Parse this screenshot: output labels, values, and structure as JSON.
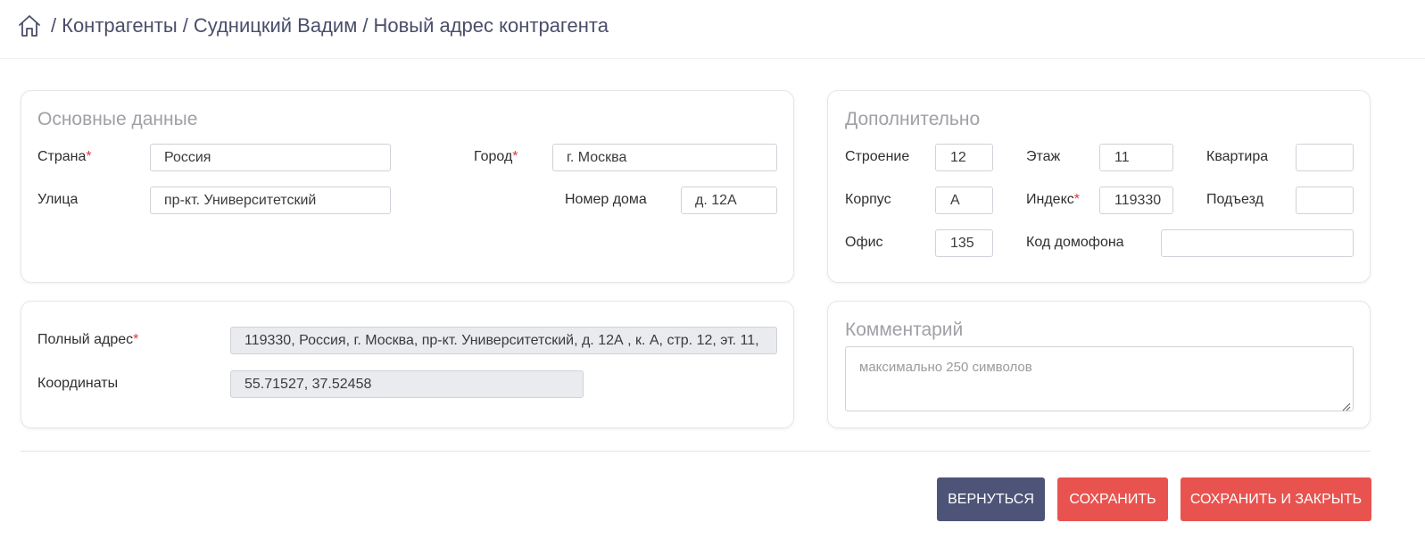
{
  "breadcrumb": {
    "home_icon": "home-icon",
    "items": [
      "Контрагенты",
      "Судницкий Вадим",
      "Новый адрес контрагента"
    ],
    "separator": "/"
  },
  "main_card": {
    "title": "Основные данные",
    "country_label": "Страна",
    "country_value": "Россия",
    "city_label": "Город",
    "city_value": "г. Москва",
    "street_label": "Улица",
    "street_value": "пр-кт. Университетский",
    "house_label": "Номер дома",
    "house_value": "д. 12А"
  },
  "extra_card": {
    "title": "Дополнительно",
    "building_label": "Строение",
    "building_value": "12",
    "floor_label": "Этаж",
    "floor_value": "11",
    "apartment_label": "Квартира",
    "apartment_value": "",
    "block_label": "Корпус",
    "block_value": "А",
    "index_label": "Индекс",
    "index_value": "119330",
    "entrance_label": "Подъезд",
    "entrance_value": "",
    "office_label": "Офис",
    "office_value": "135",
    "intercom_label": "Код домофона",
    "intercom_value": ""
  },
  "address_card": {
    "full_address_label": "Полный адрес",
    "full_address_value": "119330, Россия, г. Москва, пр-кт. Университетский, д. 12А , к. А, стр. 12, эт. 11,",
    "coords_label": "Координаты",
    "coords_value": "55.71527, 37.52458"
  },
  "comment_card": {
    "title": "Комментарий",
    "placeholder": "максимально 250 символов"
  },
  "buttons": {
    "back": "Вернуться",
    "save": "Сохранить",
    "save_close": "Сохранить и закрыть"
  },
  "required_mark": "*",
  "colors": {
    "primary_dark": "#4e5478",
    "accent_red": "#e9534f",
    "required": "#e0383e"
  }
}
